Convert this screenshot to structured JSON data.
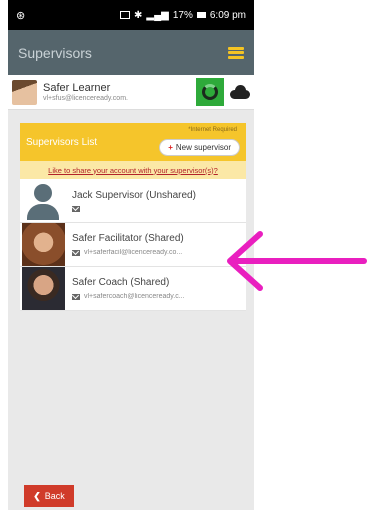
{
  "status_bar": {
    "left_icon": "notification-icon",
    "battery": "17%",
    "time": "6:09 pm"
  },
  "app_bar": {
    "title": "Supervisors",
    "menu_icon": "hamburger-icon"
  },
  "learner": {
    "name": "Safer Learner",
    "email": "vl+sfus@licenceready.com."
  },
  "panel": {
    "title": "Supervisors List",
    "internet_note": "*Internet Required",
    "new_button_label": "New supervisor",
    "share_link": "Like to share your account with your supervisor(s)?"
  },
  "supervisors": [
    {
      "name": "Jack Supervisor (Unshared)",
      "email": ""
    },
    {
      "name": "Safer Facilitator (Shared)",
      "email": "vl+saferfacil@licenceready.co..."
    },
    {
      "name": "Safer Coach (Shared)",
      "email": "vl+safercoach@licenceready.c..."
    }
  ],
  "back_button_label": "Back",
  "colors": {
    "app_bar": "#55656c",
    "accent_yellow": "#f5c52b",
    "back_red": "#d03b2a",
    "arrow_magenta": "#e91fbf"
  }
}
